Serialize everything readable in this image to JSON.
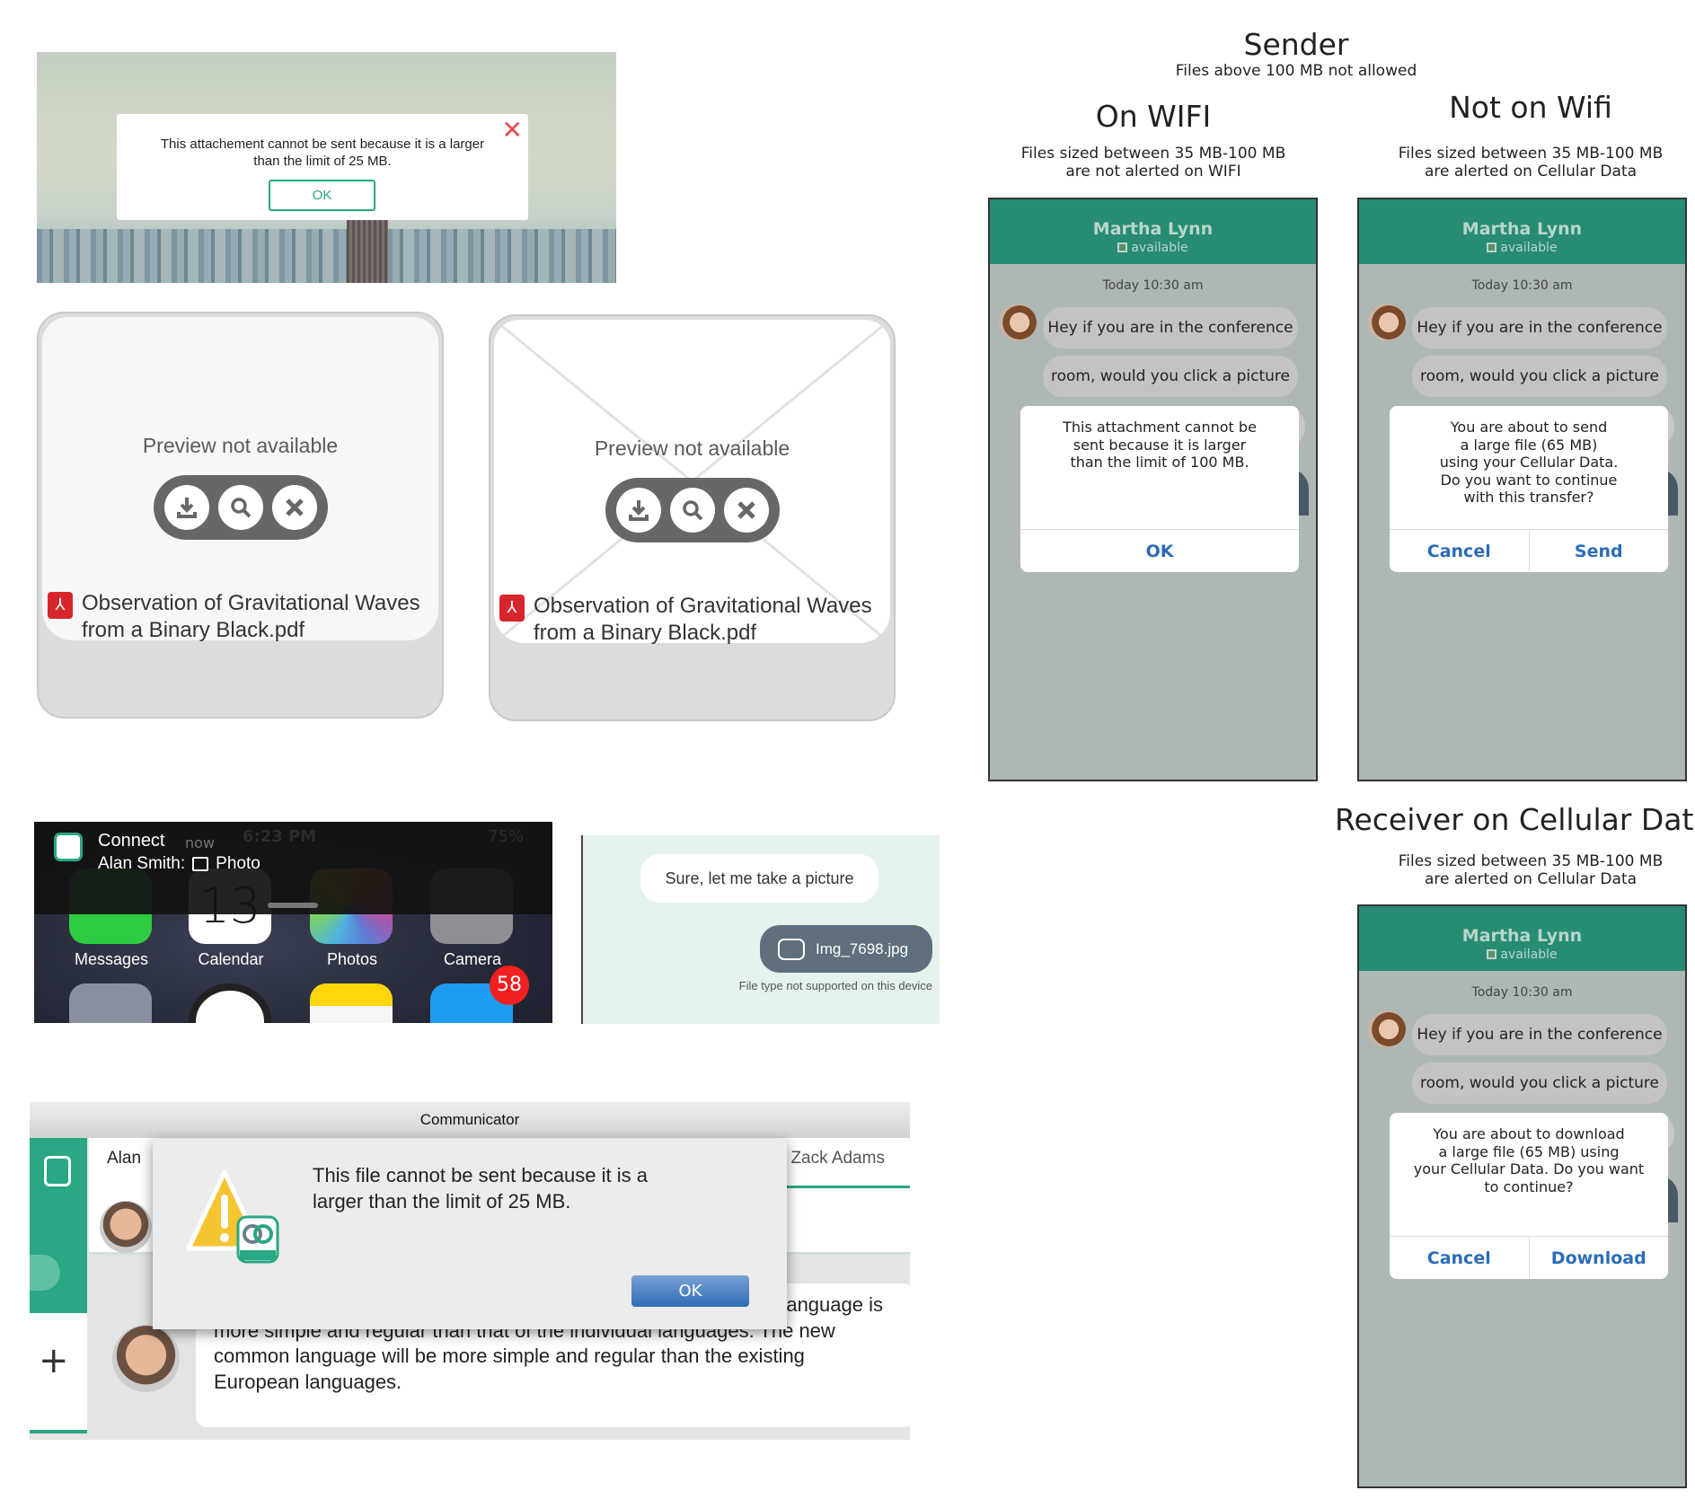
{
  "city_alert": {
    "message": "This attachement cannot be sent because it is a larger than the limit of 25 MB.",
    "ok": "OK",
    "close_icon": "close-icon"
  },
  "cards": [
    {
      "preview": "Preview not available",
      "title_line1": "Observation of Gravitational Waves",
      "title_line2": "from a Binary Black.pdf",
      "placeholder_cross": false
    },
    {
      "preview": "Preview not available",
      "title_line1": "Observation of Gravitational Waves",
      "title_line2": "from a Binary Black.pdf",
      "placeholder_cross": true
    }
  ],
  "sender": {
    "title": "Sender",
    "subtitle": "Files above 100 MB not allowed"
  },
  "wifi": {
    "title": "On WIFI",
    "sub1": "Files sized between 35 MB-100 MB",
    "sub2": "are not alerted on WIFI"
  },
  "nowifi": {
    "title": "Not on Wifi",
    "sub1": "Files sized between 35 MB-100 MB",
    "sub2": "are alerted on Cellular Data"
  },
  "receiver": {
    "title": "Receiver on Cellular Data",
    "sub1": "Files sized between 35 MB-100 MB",
    "sub2": "are alerted on Cellular Data"
  },
  "phones": [
    {
      "name": "Martha Lynn",
      "status": "available",
      "time": "Today 10:30 am",
      "msg1": "Hey if you are in the conference",
      "msg2": "room, would you click a picture",
      "msg3": "?",
      "dialog": [
        "This attachment cannot be",
        "sent because it is larger",
        "than the limit of 100 MB."
      ],
      "buttons": [
        "OK"
      ]
    },
    {
      "name": "Martha Lynn",
      "status": "available",
      "time": "Today 10:30 am",
      "msg1": "Hey if you are in the conference",
      "msg2": "room, would you click a picture",
      "msg3": "?",
      "dialog": [
        "You are about to send",
        "a large file (65 MB)",
        "using your Cellular Data.",
        "Do you want to continue",
        "with this transfer?"
      ],
      "buttons": [
        "Cancel",
        "Send"
      ]
    },
    {
      "name": "Martha Lynn",
      "status": "available",
      "time": "Today 10:30 am",
      "msg1": "Hey if you are in the conference",
      "msg2": "room, would you click a picture",
      "msg3": "?",
      "dialog": [
        "You are about to download",
        "a large file (65 MB) using",
        "your Cellular Data. Do you want",
        "to continue?"
      ],
      "buttons": [
        "Cancel",
        "Download"
      ]
    }
  ],
  "notification": {
    "app": "Connect",
    "time": "now",
    "sender": "Alan Smith:",
    "content": "Photo",
    "status_time": "6:23 PM",
    "battery": "75%",
    "apps": [
      "Messages",
      "Calendar",
      "Photos",
      "Camera"
    ],
    "badge": "58",
    "calendar_day": "13"
  },
  "chat": {
    "received": "Sure, let me take a picture",
    "file": "Img_7698.jpg",
    "note": "File type not supported on this device"
  },
  "communicator": {
    "title": "Communicator",
    "tab1": "Alan",
    "tab2": "Zack Adams",
    "dialog_message": "This file cannot be sent because it is a larger than the limit of 25 MB.",
    "ok": "OK",
    "badge_label": "uc-one",
    "message_visible_end": "language is",
    "message_lines": [
      "more simple and regular than that of the individual languages. The new",
      "common language will be more simple and regular than the existing",
      "European languages."
    ]
  },
  "colors": {
    "brand_green": "#288c74",
    "link_blue": "#2b6cb8",
    "alert_red": "#e24c4c"
  }
}
